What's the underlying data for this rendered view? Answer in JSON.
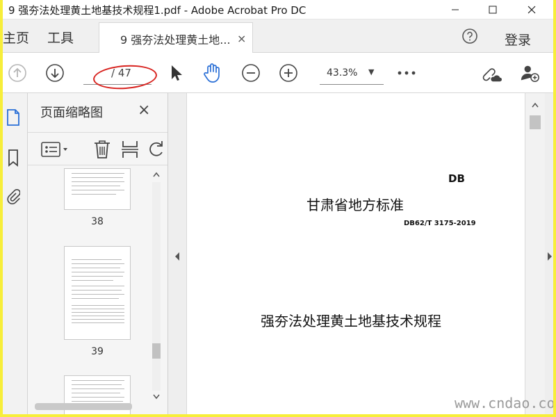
{
  "window": {
    "title": "9 强夯法处理黄土地基技术规程1.pdf - Adobe Acrobat Pro DC"
  },
  "tabs": {
    "home": "主页",
    "tools": "工具",
    "document": "9 强夯法处理黄土地...",
    "close": "×",
    "login": "登录"
  },
  "toolbar": {
    "page_value": "",
    "page_total": "/ 47",
    "zoom": "43.3%",
    "zoom_caret": "▼"
  },
  "panel": {
    "title": "页面缩略图",
    "close": "×",
    "thumbnails": [
      {
        "label": "38"
      },
      {
        "label": "39"
      }
    ]
  },
  "document_page": {
    "db": "DB",
    "standard_title": "甘肃省地方标准",
    "standard_code": "DB62/T 3175-2019",
    "heading": "强夯法处理黄土地基技术规程"
  },
  "watermark": "www.cndao.com",
  "colors": {
    "accent_blue": "#2a6fd6",
    "annotation_red": "#d8231f",
    "highlight_yellow": "#f7ee3a"
  }
}
